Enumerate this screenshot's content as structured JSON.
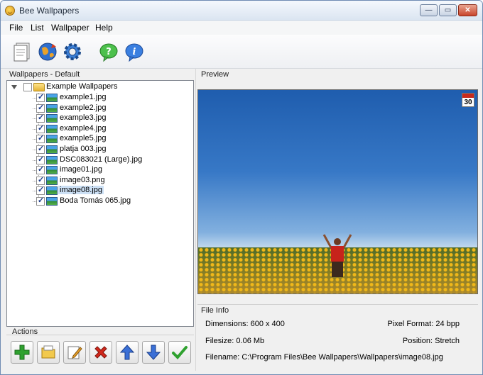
{
  "window": {
    "title": "Bee Wallpapers",
    "controls": {
      "minimize": "—",
      "maximize": "▭",
      "close": "✕"
    }
  },
  "menu": [
    "File",
    "List",
    "Wallpaper",
    "Help"
  ],
  "toolbar": {
    "icons": [
      "new-list-icon",
      "globe-icon",
      "settings-gear-icon",
      "help-icon",
      "info-icon"
    ]
  },
  "tree": {
    "label": "Wallpapers - Default",
    "root": {
      "label": "Example Wallpapers",
      "checked": false
    },
    "items": [
      {
        "label": "example1.jpg",
        "checked": true
      },
      {
        "label": "example2.jpg",
        "checked": true
      },
      {
        "label": "example3.jpg",
        "checked": true
      },
      {
        "label": "example4.jpg",
        "checked": true
      },
      {
        "label": "example5.jpg",
        "checked": true
      },
      {
        "label": "platja 003.jpg",
        "checked": true
      },
      {
        "label": "DSC083021 (Large).jpg",
        "checked": true
      },
      {
        "label": "image01.jpg",
        "checked": true
      },
      {
        "label": "image03.png",
        "checked": true
      },
      {
        "label": "image08.jpg",
        "checked": true,
        "selected": true
      },
      {
        "label": "Boda Tomás 065.jpg",
        "checked": true
      }
    ]
  },
  "actions": {
    "label": "Actions",
    "buttons": [
      "add-icon",
      "open-folder-icon",
      "edit-icon",
      "delete-icon",
      "move-up-icon",
      "move-down-icon",
      "apply-check-icon"
    ]
  },
  "preview": {
    "label": "Preview",
    "calendar_day": "30"
  },
  "file_info": {
    "label": "File Info",
    "dimensions": "Dimensions: 600 x 400",
    "pixel_format": "Pixel Format: 24 bpp",
    "filesize": "Filesize: 0.06 Mb",
    "position": "Position: Stretch",
    "filename": "Filename: C:\\Program Files\\Bee Wallpapers\\Wallpapers\\image08.jpg"
  },
  "colors": {
    "accent": "#1d3c8c",
    "selection": "#cce0f5",
    "add_green": "#2fa12f",
    "delete_red": "#d1281c",
    "arrow_blue": "#3a6fd6"
  }
}
